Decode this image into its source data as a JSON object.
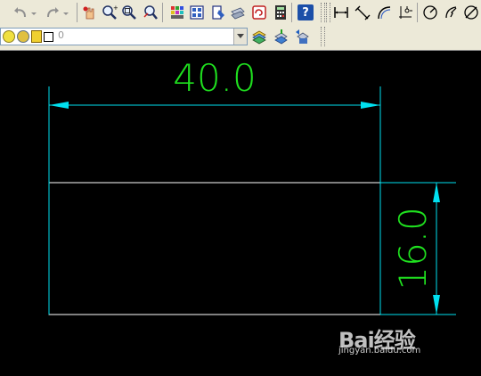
{
  "colors": {
    "toolbar_bg": "#ece9d8",
    "canvas_bg": "#000000",
    "dimension_line": "#00e0f0",
    "dimension_text": "#1fe01f",
    "geometry": "#ffffff"
  },
  "toolbar": {
    "buttons": [
      {
        "icon": "undo-icon"
      },
      {
        "icon": "redo-icon"
      },
      {
        "icon": "pan-realtime-icon"
      },
      {
        "icon": "zoom-realtime-icon"
      },
      {
        "icon": "zoom-window-icon"
      },
      {
        "icon": "zoom-previous-icon"
      },
      {
        "icon": "properties-icon"
      },
      {
        "icon": "design-center-icon"
      },
      {
        "icon": "tool-palettes-icon"
      },
      {
        "icon": "sheet-set-icon"
      },
      {
        "icon": "markup-icon"
      },
      {
        "icon": "calculator-icon"
      },
      {
        "icon": "help-icon"
      }
    ],
    "help_label": "?"
  },
  "dimension_toolbar": {
    "buttons": [
      {
        "icon": "linear-dimension-icon"
      },
      {
        "icon": "aligned-dimension-icon"
      },
      {
        "icon": "arc-length-icon"
      },
      {
        "icon": "ordinate-dimension-icon"
      },
      {
        "icon": "radius-dimension-icon"
      },
      {
        "icon": "jogged-dimension-icon"
      },
      {
        "icon": "diameter-dimension-icon"
      }
    ]
  },
  "layers": {
    "current_layer": "0",
    "buttons": [
      {
        "icon": "layer-properties-icon"
      },
      {
        "icon": "make-current-icon"
      },
      {
        "icon": "layer-previous-icon"
      }
    ]
  },
  "drawing": {
    "horizontal_dimension": "40.0",
    "vertical_dimension": "16.0"
  },
  "watermark": {
    "brand": "Bai经验",
    "url": "jingyan.baidu.com"
  }
}
